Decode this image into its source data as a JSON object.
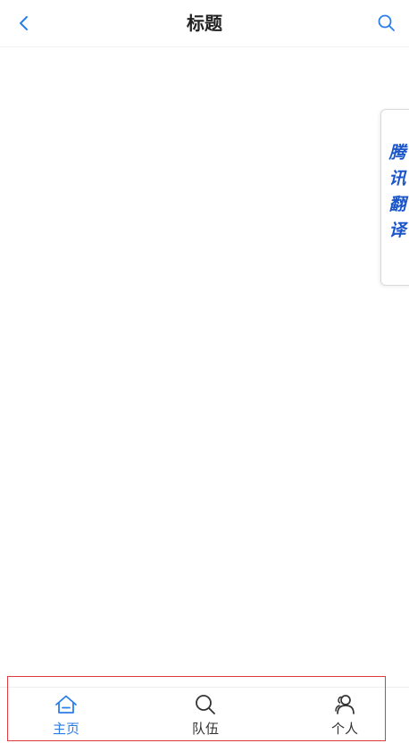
{
  "header": {
    "title": "标题",
    "back_icon": "chevron-left-icon",
    "search_icon": "search-icon",
    "accent_color": "#2b7de9"
  },
  "translate_widget": {
    "label": "腾讯翻译",
    "color": "#1a55c9"
  },
  "tabbar": {
    "active_color": "#2b7de9",
    "inactive_color": "#333333",
    "outline_color": "#e0393e",
    "tabs": [
      {
        "label": "主页",
        "icon": "home-icon",
        "active": true
      },
      {
        "label": "队伍",
        "icon": "search-icon",
        "active": false
      },
      {
        "label": "个人",
        "icon": "users-icon",
        "active": false
      }
    ]
  }
}
